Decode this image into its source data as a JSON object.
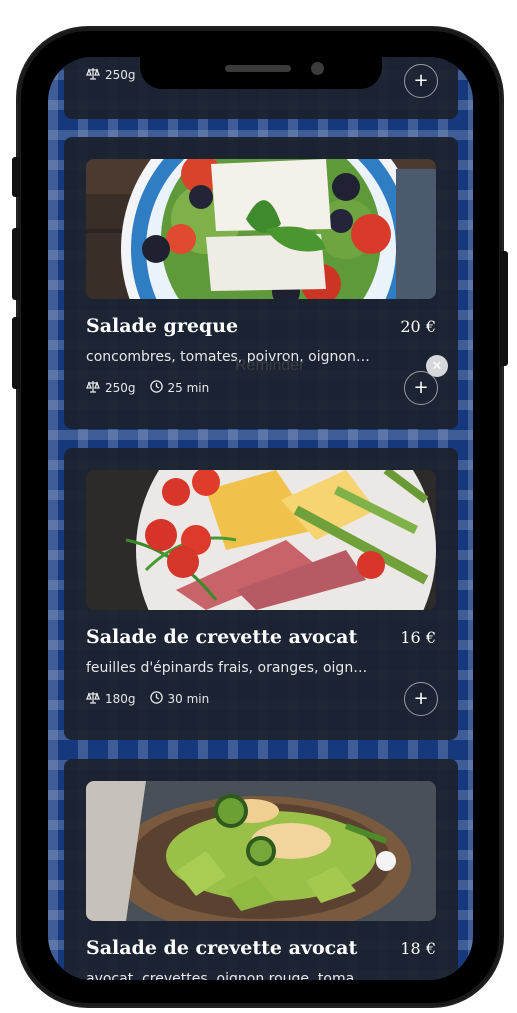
{
  "reminder_label": "Reminder",
  "colors": {
    "card_bg": "#1c222e",
    "tablecloth_blue": "#16397e",
    "text": "#ffffff"
  },
  "partial_card": {
    "weight": "250g",
    "add_label": "+"
  },
  "cards": [
    {
      "title": "Salade greque",
      "price": "20 €",
      "description": "concombres, tomates, poivron, oignon…",
      "weight": "250g",
      "time": "25 min",
      "add_label": "+"
    },
    {
      "title": "Salade de crevette avocat",
      "price": "16 €",
      "description": "feuilles d'épinards frais, oranges, oign…",
      "weight": "180g",
      "time": "30 min",
      "add_label": "+"
    },
    {
      "title": "Salade de crevette avocat",
      "price": "18 €",
      "description": "avocat, crevettes, oignon rouge, toma…"
    }
  ],
  "icons": {
    "weight": "scale-icon",
    "time": "clock-icon",
    "add": "plus-icon",
    "close": "close-icon"
  }
}
